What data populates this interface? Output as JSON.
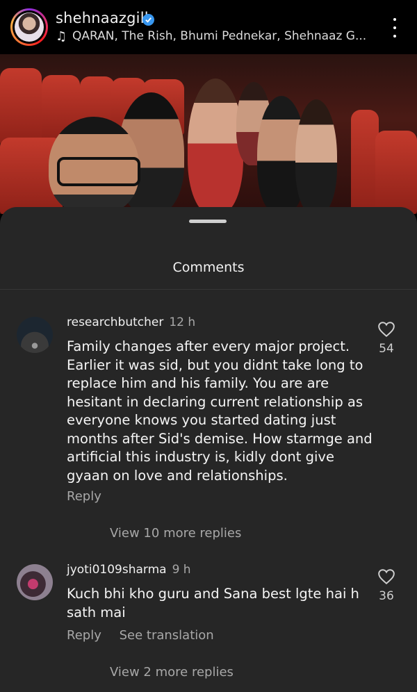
{
  "header": {
    "username": "shehnaazgill",
    "audio": "QARAN, The Rish, Bhumi Pednekar, Shehnaaz G..."
  },
  "icons": {
    "verified": "verified-badge-icon",
    "music": "music-note-icon",
    "more": "more-vertical-icon",
    "like": "heart-icon"
  },
  "sheet": {
    "title": "Comments"
  },
  "comments": [
    {
      "username": "researchbutcher",
      "time": "12 h",
      "text": "Family changes after every major project. Earlier it was sid, but you didnt take long to replace him and his family.  You are are hesitant in declaring current relationship as everyone knows you started dating just months after Sid's demise. How starmge and artificial this industry is, kidly dont give gyaan on love and relationships.",
      "reply_label": "Reply",
      "likes": "54",
      "more_replies": "View 10 more replies"
    },
    {
      "username": "jyoti0109sharma",
      "time": "9 h",
      "text": "Kuch bhi kho guru and Sana best lgte hai h sath mai",
      "reply_label": "Reply",
      "translate_label": "See translation",
      "likes": "36",
      "more_replies": "View 2 more replies"
    }
  ],
  "colors": {
    "background": "#000000",
    "sheet": "#262626",
    "secondary_text": "#a8a8a8",
    "verified": "#3897f0"
  }
}
